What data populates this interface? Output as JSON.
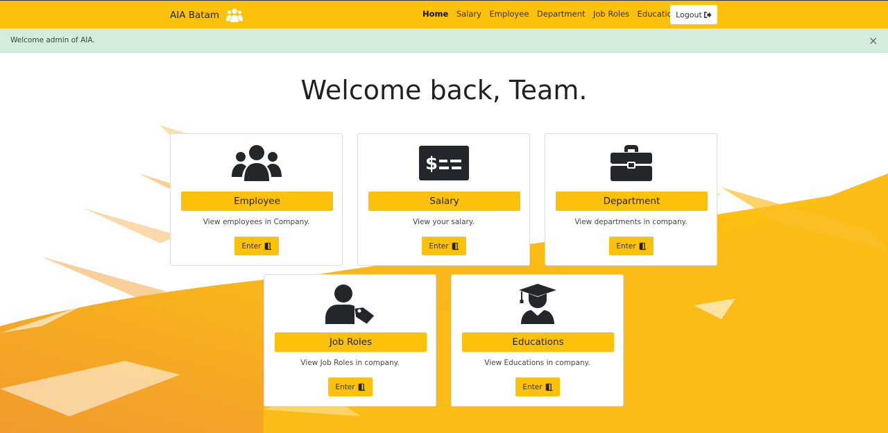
{
  "navbar": {
    "brand": "AIA Batam",
    "brand_icon": "users-icon",
    "links": [
      "Home",
      "Salary",
      "Employee",
      "Department",
      "Job Roles",
      "Educations"
    ],
    "active_link": "Home",
    "logout_label": "Logout",
    "logout_icon": "sign-out-icon"
  },
  "alert": {
    "message": "Welcome admin of AIA.",
    "close_symbol": "×"
  },
  "page_title": "Welcome back, Team.",
  "cards": [
    {
      "title": "Employee",
      "description": "View employees in Company.",
      "enter_label": "Enter",
      "icon": "users-icon"
    },
    {
      "title": "Salary",
      "description": "View your salary.",
      "enter_label": "Enter",
      "icon": "money-check-icon"
    },
    {
      "title": "Department",
      "description": "View departments in company.",
      "enter_label": "Enter",
      "icon": "briefcase-icon"
    },
    {
      "title": "Job Roles",
      "description": "View Job Roles in company.",
      "enter_label": "Enter",
      "icon": "user-tag-icon"
    },
    {
      "title": "Educations",
      "description": "View Educations in company.",
      "enter_label": "Enter",
      "icon": "graduate-icon"
    }
  ],
  "colors": {
    "accent": "#fcc10a",
    "alert_bg": "#d4ecdb",
    "icon": "#23272b"
  }
}
